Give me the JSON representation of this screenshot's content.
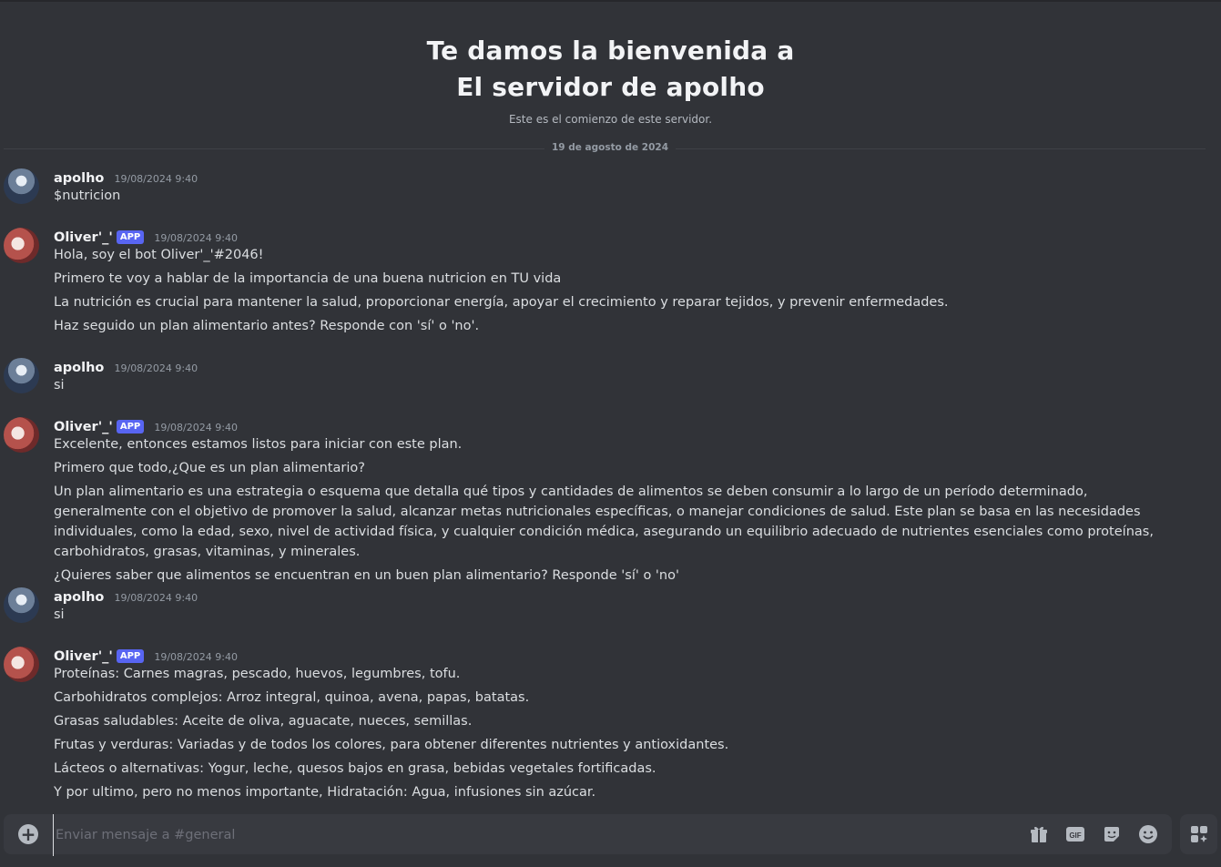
{
  "welcome": {
    "title_line1": "Te damos la bienvenida a",
    "title_line2": "El servidor de apolho",
    "subtitle": "Este es el comienzo de este servidor."
  },
  "date_divider": "19 de agosto de 2024",
  "messages": [
    {
      "author": "apolho",
      "timestamp": "19/08/2024 9:40",
      "lines": [
        "$nutricion"
      ]
    },
    {
      "author": "Oliver'_'",
      "badge": "APP",
      "timestamp": "19/08/2024 9:40",
      "lines": [
        "Hola, soy el bot Oliver'_'#2046!",
        "Primero te voy a hablar de la importancia de una buena nutricion en TU vida",
        "La nutrición es crucial para mantener la salud, proporcionar energía, apoyar el crecimiento y reparar tejidos, y prevenir enfermedades.",
        "Haz seguido un plan alimentario antes? Responde con 'sí' o 'no'."
      ]
    },
    {
      "author": "apolho",
      "timestamp": "19/08/2024 9:40",
      "lines": [
        "si"
      ]
    },
    {
      "author": "Oliver'_'",
      "badge": "APP",
      "timestamp": "19/08/2024 9:40",
      "lines": [
        "Excelente, entonces estamos listos para iniciar con este plan.",
        "Primero que todo,¿Que es un plan alimentario?",
        "Un plan alimentario es una estrategia o esquema que detalla qué tipos y cantidades de alimentos se deben consumir a lo largo de un período determinado, generalmente con el objetivo de promover la salud, alcanzar metas nutricionales específicas, o manejar condiciones de salud. Este plan se basa en las necesidades individuales, como la edad, sexo, nivel de actividad física, y cualquier condición médica, asegurando un equilibrio adecuado de nutrientes esenciales como proteínas, carbohidratos, grasas, vitaminas, y minerales.",
        "¿Quieres saber que alimentos se encuentran en un buen plan alimentario? Responde 'sí' o 'no'"
      ]
    },
    {
      "author": "apolho",
      "timestamp": "19/08/2024 9:40",
      "lines": [
        "si"
      ]
    },
    {
      "author": "Oliver'_'",
      "badge": "APP",
      "timestamp": "19/08/2024 9:40",
      "lines": [
        "Proteínas: Carnes magras, pescado, huevos, legumbres, tofu.",
        "Carbohidratos complejos: Arroz integral, quinoa, avena, papas, batatas.",
        "Grasas saludables: Aceite de oliva, aguacate, nueces, semillas.",
        "Frutas y verduras: Variadas y de todos los colores, para obtener diferentes nutrientes y antioxidantes.",
        "Lácteos o alternativas: Yogur, leche, quesos bajos en grasa, bebidas vegetales fortificadas.",
        "Y por ultimo, pero no menos importante, Hidratación: Agua, infusiones sin azúcar."
      ]
    }
  ],
  "composer": {
    "placeholder": "Enviar mensaje a #general",
    "icons": [
      "plus-circle-icon",
      "gift-icon",
      "gif-icon",
      "sticker-icon",
      "emoji-icon",
      "apps-icon"
    ],
    "gif_label": "GIF"
  }
}
